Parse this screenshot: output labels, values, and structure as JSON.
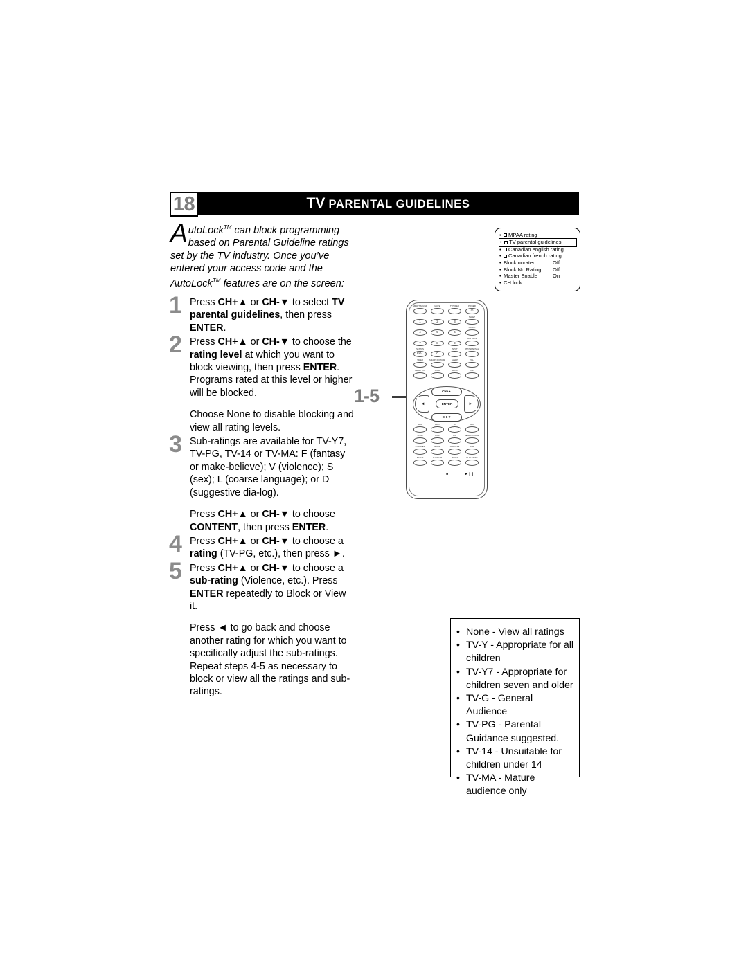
{
  "header": {
    "page_number": "18",
    "title_lead": "TV",
    "title_rest": "PARENTAL GUIDELINES"
  },
  "intro": {
    "dropcap": "A",
    "line1": "utoLock",
    "tm1": "TM",
    "line1_rest": " can block programming",
    "line2": "based on Parental Guideline ratings set",
    "line3": "by the TV industry.",
    "line4": "Once you’ve entered your access code",
    "line5a": "and the AutoLock",
    "tm2": "TM",
    "line5b": " features are on the",
    "line6": "screen:"
  },
  "osd": {
    "rows": [
      {
        "label": "MPAA rating",
        "checkbox": true,
        "value": "",
        "selected": false
      },
      {
        "label": "TV parental guidelines",
        "checkbox": true,
        "value": "",
        "selected": true
      },
      {
        "label": "Canadian english rating",
        "checkbox": true,
        "value": "",
        "selected": false
      },
      {
        "label": "Canadian french rating",
        "checkbox": true,
        "value": "",
        "selected": false
      },
      {
        "label": "Block unrated",
        "checkbox": false,
        "value": "Off",
        "selected": false
      },
      {
        "label": "Block No Rating",
        "checkbox": false,
        "value": "Off",
        "selected": false
      },
      {
        "label": "Master Enable",
        "checkbox": false,
        "value": "On",
        "selected": false
      },
      {
        "label": "CH lock",
        "checkbox": false,
        "value": "",
        "selected": false
      }
    ]
  },
  "steps": [
    {
      "num": "1",
      "paras": [
        [
          {
            "t": "Press ",
            "b": false
          },
          {
            "t": "CH+▲",
            "b": true
          },
          {
            "t": " or ",
            "b": false
          },
          {
            "t": "CH-▼",
            "b": true
          },
          {
            "t": " to select ",
            "b": false
          },
          {
            "t": "TV parental guidelines",
            "b": true
          },
          {
            "t": ", then press ",
            "b": false
          },
          {
            "t": "ENTER",
            "b": true
          },
          {
            "t": ".",
            "b": false
          }
        ]
      ]
    },
    {
      "num": "2",
      "paras": [
        [
          {
            "t": "Press ",
            "b": false
          },
          {
            "t": "CH+▲",
            "b": true
          },
          {
            "t": " or ",
            "b": false
          },
          {
            "t": "CH-▼",
            "b": true
          },
          {
            "t": " to choose the ",
            "b": false
          },
          {
            "t": "rating level",
            "b": true
          },
          {
            "t": " at which you want to block viewing, then press ",
            "b": false
          },
          {
            "t": "ENTER",
            "b": true
          },
          {
            "t": ". Programs rated at this level or higher will be blocked.",
            "b": false
          }
        ],
        [
          {
            "t": "Choose None to disable blocking and view all rating levels.",
            "b": false
          }
        ]
      ]
    },
    {
      "num": "3",
      "paras": [
        [
          {
            "t": "Sub-ratings are available for TV-Y7, TV-PG, TV-14 or TV-MA: F (fantasy or make-believe); V (violence); S (sex); L (coarse language); or D (suggestive dia-log).",
            "b": false
          }
        ],
        [
          {
            "t": "Press ",
            "b": false
          },
          {
            "t": "CH+▲",
            "b": true
          },
          {
            "t": " or ",
            "b": false
          },
          {
            "t": "CH-▼",
            "b": true
          },
          {
            "t": " to choose ",
            "b": false
          },
          {
            "t": "CONTENT",
            "b": true
          },
          {
            "t": ", then press ",
            "b": false
          },
          {
            "t": "ENTER",
            "b": true
          },
          {
            "t": ".",
            "b": false
          }
        ]
      ]
    },
    {
      "num": "4",
      "paras": [
        [
          {
            "t": "Press ",
            "b": false
          },
          {
            "t": "CH+▲",
            "b": true
          },
          {
            "t": " or ",
            "b": false
          },
          {
            "t": "CH-▼",
            "b": true
          },
          {
            "t": " to choose a ",
            "b": false
          },
          {
            "t": "rating",
            "b": true
          },
          {
            "t": " (TV-PG, etc.), then press ►.",
            "b": false
          }
        ]
      ]
    },
    {
      "num": "5",
      "paras": [
        [
          {
            "t": "Press ",
            "b": false
          },
          {
            "t": "CH+▲",
            "b": true
          },
          {
            "t": " or ",
            "b": false
          },
          {
            "t": "CH-▼",
            "b": true
          },
          {
            "t": " to choose a ",
            "b": false
          },
          {
            "t": "sub-rating",
            "b": true
          },
          {
            "t": " (Violence, etc.). Press ",
            "b": false
          },
          {
            "t": "ENTER",
            "b": true
          },
          {
            "t": " repeatedly to Block or View it.",
            "b": false
          }
        ],
        [
          {
            "t": "Press ◄ to go back and choose another rating for which you want to specifically adjust the sub-ratings. Repeat steps 4-5 as necessary to block or view all the ratings and sub-ratings.",
            "b": false
          }
        ]
      ]
    }
  ],
  "callout": {
    "label": "1-5"
  },
  "remote": {
    "nav": {
      "up": "CH+▲",
      "down": "CH-▼",
      "enter": "ENTER",
      "left": "◄",
      "right": "►"
    },
    "top_rows": [
      [
        {
          "label": "SMART SOUND",
          "text": ""
        },
        {
          "label": "MUTE",
          "text": ""
        },
        {
          "label": "TV/VIDEO",
          "text": ""
        },
        {
          "label": "POWER",
          "text": "⏻"
        }
      ],
      [
        {
          "label": "",
          "text": "1"
        },
        {
          "label": "",
          "text": "2"
        },
        {
          "label": "",
          "text": "3"
        },
        {
          "label": "SLEEP",
          "text": ""
        }
      ],
      [
        {
          "label": "",
          "text": "4"
        },
        {
          "label": "",
          "text": "5"
        },
        {
          "label": "",
          "text": "6"
        },
        {
          "label": "CLOCK",
          "text": ""
        }
      ],
      [
        {
          "label": "",
          "text": "7"
        },
        {
          "label": "",
          "text": "8"
        },
        {
          "label": "",
          "text": "9"
        },
        {
          "label": "A/CH RTN",
          "text": ""
        }
      ],
      [
        {
          "label": "STATUS",
          "text": "FAV."
        },
        {
          "label": "",
          "text": "0"
        },
        {
          "label": "INPUT",
          "text": ""
        },
        {
          "label": "PIP/SWAP/SEL",
          "text": ""
        }
      ],
      [
        {
          "label": "TIMER",
          "text": ""
        },
        {
          "label": "SMART PICTURE",
          "text": ""
        },
        {
          "label": "SLEEP",
          "text": ""
        },
        {
          "label": "VOL+",
          "text": ""
        }
      ],
      [
        {
          "label": "SMART PIC",
          "text": ""
        },
        {
          "label": "SURF",
          "text": ""
        },
        {
          "label": "MENU",
          "text": ""
        },
        {
          "label": "VOL-",
          "text": ""
        }
      ]
    ],
    "bottom_rows": [
      [
        {
          "label": "REW"
        },
        {
          "label": "PLAY"
        },
        {
          "label": "FF"
        },
        {
          "label": "REC"
        }
      ],
      [
        {
          "label": "SLOW"
        },
        {
          "label": "STEP"
        },
        {
          "label": "A/C"
        },
        {
          "label": "SEARCH MODE"
        }
      ],
      [
        {
          "label": "CHANNEL"
        },
        {
          "label": "SPACE"
        },
        {
          "label": "SUBTITLE"
        },
        {
          "label": "DISP"
        }
      ],
      [
        {
          "label": "SETUP"
        },
        {
          "label": "AUDIO LR"
        },
        {
          "label": "ZOOM"
        },
        {
          "label": "PLAY MODE"
        }
      ]
    ],
    "transport": {
      "stop": "■",
      "play_pause": "►❙❙"
    }
  },
  "ratings_box": {
    "items": [
      "None - View all ratings",
      "TV-Y - Appropriate for all children",
      "TV-Y7 - Appropriate for children seven and older",
      "TV-G - General Audience",
      "TV-PG - Parental Guidance suggested.",
      "TV-14 - Unsuitable for children under 14",
      "TV-MA - Mature audience only"
    ]
  }
}
